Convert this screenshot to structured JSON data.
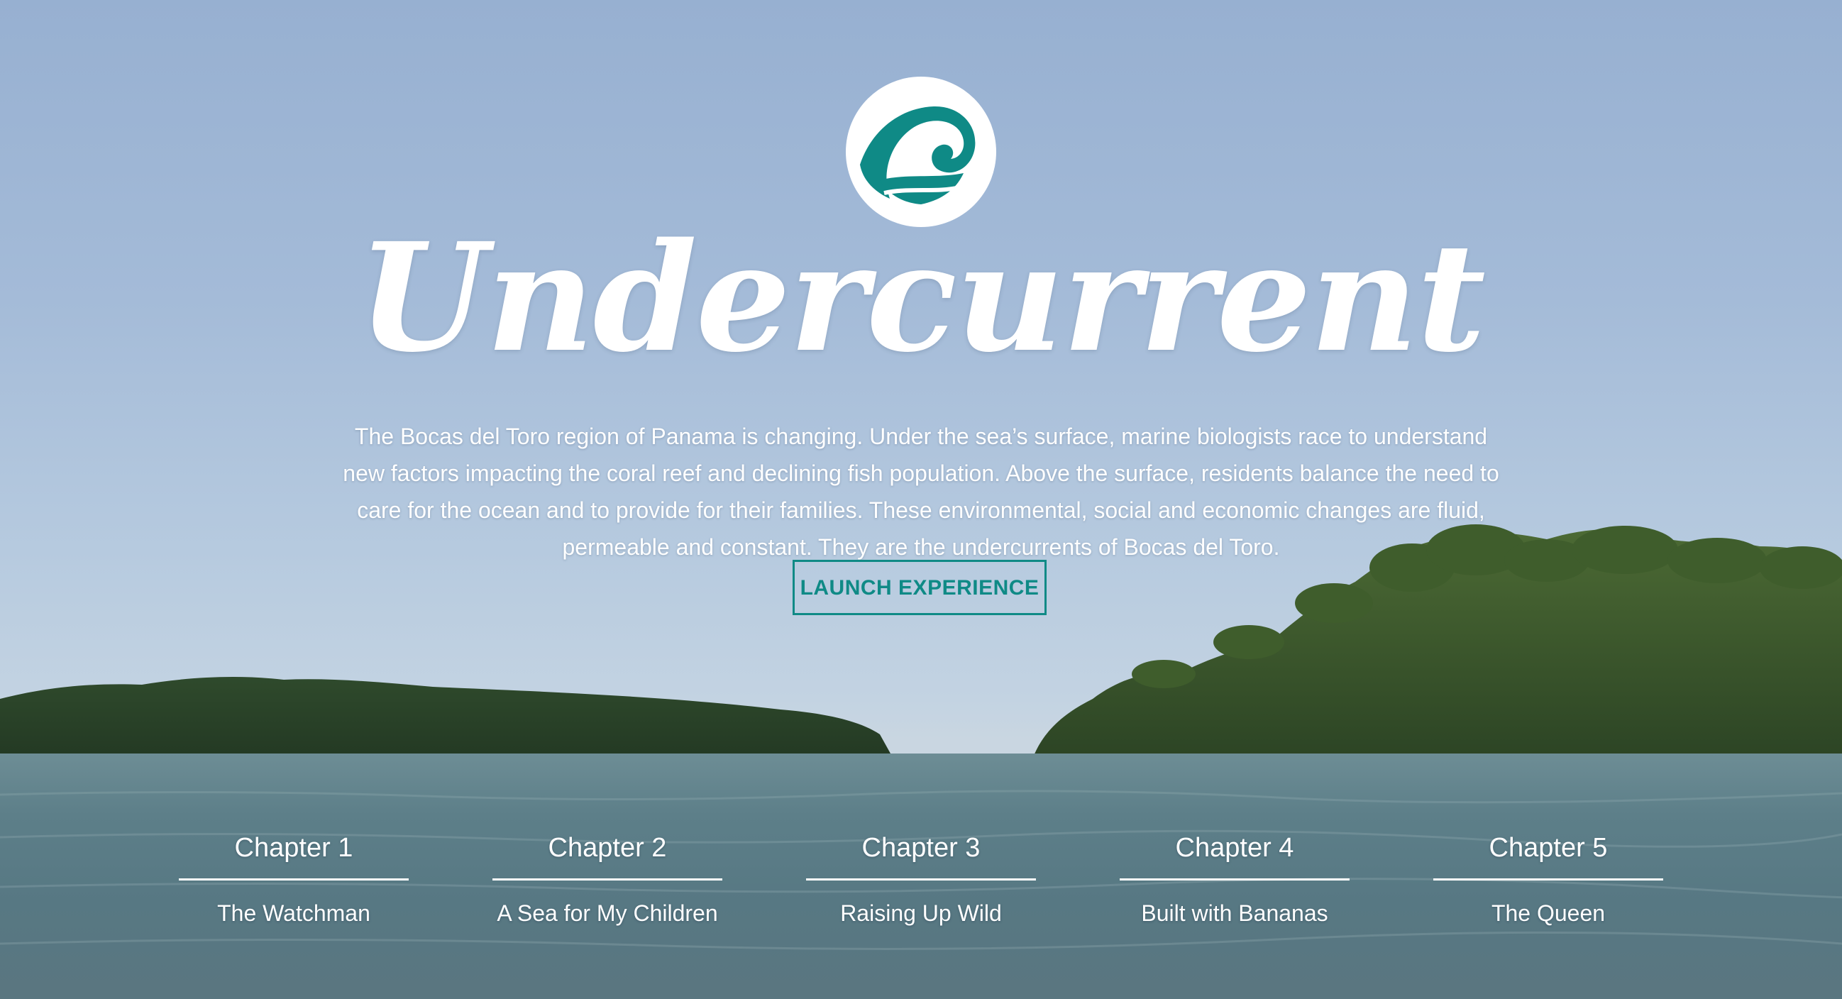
{
  "brand": {
    "logo_icon": "wave-icon",
    "title": "Undercurrent",
    "accent_color": "#0f8a86"
  },
  "intro": {
    "text": "The Bocas del Toro region of Panama is changing. Under the sea’s surface, marine biologists race to understand new factors impacting the coral reef and declining fish population. Above the surface, residents balance the need to care for the ocean and to provide for their families. These environmental, social and economic changes are fluid, permeable and constant. They are the undercurrents of Bocas del Toro."
  },
  "cta": {
    "label": "LAUNCH EXPERIENCE"
  },
  "chapters": [
    {
      "number": "Chapter 1",
      "title": "The Watchman"
    },
    {
      "number": "Chapter 2",
      "title": "A Sea for My Children"
    },
    {
      "number": "Chapter 3",
      "title": "Raising Up Wild"
    },
    {
      "number": "Chapter 4",
      "title": "Built with Bananas"
    },
    {
      "number": "Chapter 5",
      "title": "The Queen"
    }
  ]
}
